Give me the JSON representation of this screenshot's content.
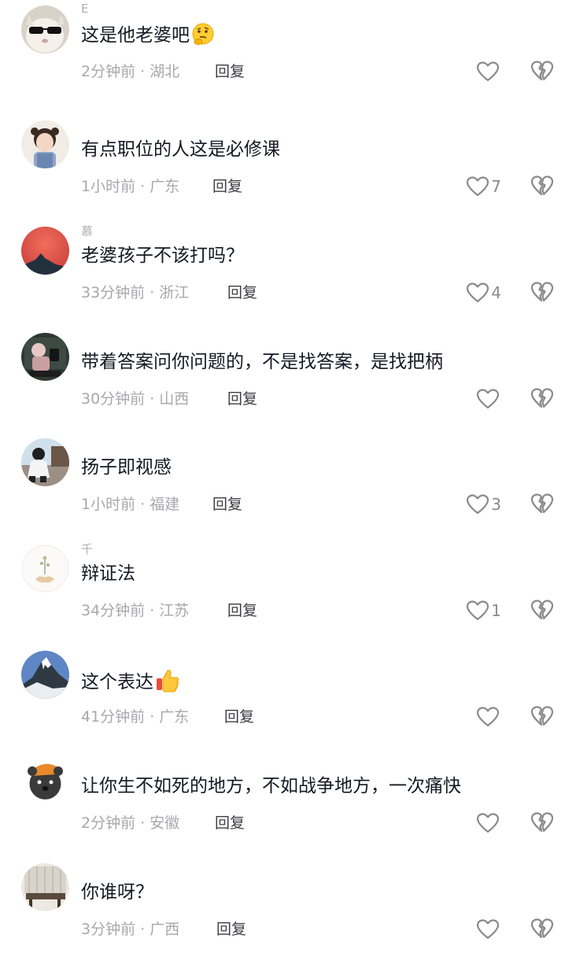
{
  "comments": [
    {
      "username": "E",
      "text": "这是他老婆吧",
      "emoji": "thinking-face-emoji",
      "time": "2分钟前 · 湖北",
      "reply": "回复",
      "likes": ""
    },
    {
      "username": "",
      "text": "有点职位的人这是必修课",
      "emoji": "",
      "time": "1小时前 · 广东",
      "reply": "回复",
      "likes": "7"
    },
    {
      "username": "慕",
      "text": "老婆孩子不该打吗？",
      "emoji": "",
      "time": "33分钟前 · 浙江",
      "reply": "回复",
      "likes": "4"
    },
    {
      "username": "",
      "text": "带着答案问你问题的，不是找答案，是找把柄",
      "emoji": "",
      "time": "30分钟前 · 山西",
      "reply": "回复",
      "likes": ""
    },
    {
      "username": "",
      "text": "扬子即视感",
      "emoji": "",
      "time": "1小时前 · 福建",
      "reply": "回复",
      "likes": "3"
    },
    {
      "username": "千",
      "text": "辩证法",
      "emoji": "",
      "time": "34分钟前 · 江苏",
      "reply": "回复",
      "likes": "1"
    },
    {
      "username": "",
      "text": "这个表达",
      "emoji": "thumbs-up-emoji",
      "time": "41分钟前 · 广东",
      "reply": "回复",
      "likes": ""
    },
    {
      "username": "",
      "text": "让你生不如死的地方，不如战争地方，一次痛快",
      "emoji": "",
      "time": "2分钟前 · 安徽",
      "reply": "回复",
      "likes": ""
    },
    {
      "username": "",
      "text": "你谁呀？",
      "emoji": "",
      "time": "3分钟前 · 广西",
      "reply": "回复",
      "likes": ""
    }
  ],
  "icons": {
    "like": "heart-outline-icon",
    "dislike": "broken-heart-icon"
  },
  "colors": {
    "text": "#161823",
    "meta": "#a8a8ac",
    "icon": "#8a8a8e"
  }
}
